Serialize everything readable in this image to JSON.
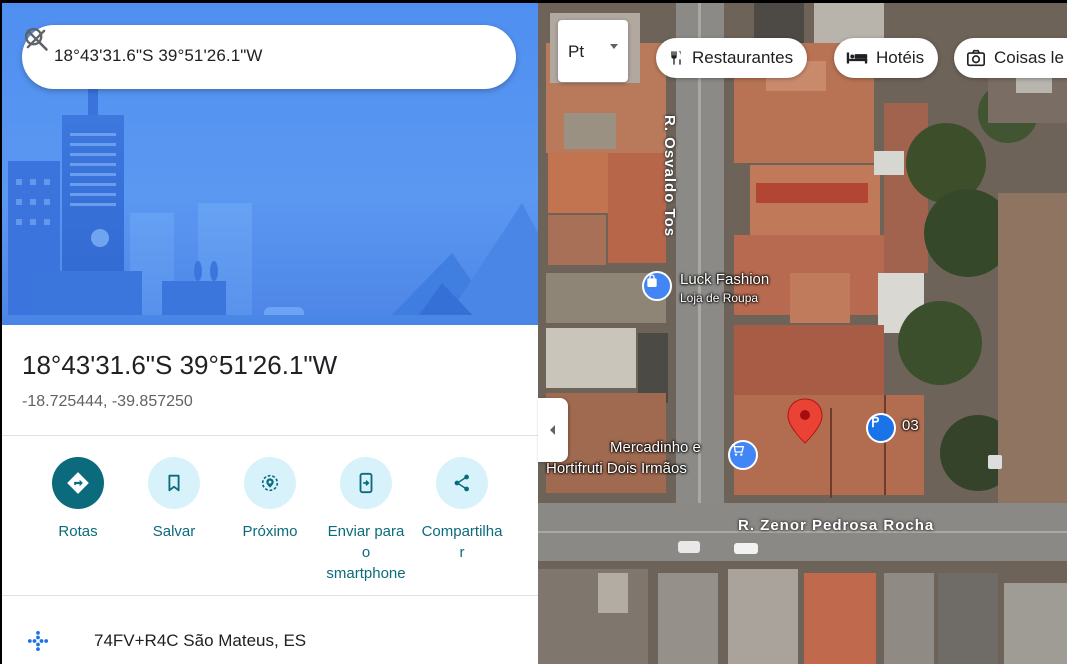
{
  "search": {
    "value": "18°43'31.6\"S 39°51'26.1\"W",
    "search_icon": "search-icon",
    "close_icon": "close-icon"
  },
  "place": {
    "title": "18°43'31.6\"S 39°51'26.1\"W",
    "decimal": "-18.725444, -39.857250"
  },
  "actions": [
    {
      "label": "Rotas",
      "icon": "directions-icon"
    },
    {
      "label": "Salvar",
      "icon": "bookmark-icon"
    },
    {
      "label": "Próximo",
      "icon": "nearby-icon"
    },
    {
      "label": "Enviar para o smartphone",
      "label_lines": [
        "Enviar para",
        "o",
        "smartphone"
      ],
      "icon": "send-to-phone-icon"
    },
    {
      "label": "Compartilhar",
      "label_lines": [
        "Compartilha",
        "r"
      ],
      "icon": "share-icon"
    }
  ],
  "plus_code": {
    "text": "74FV+R4C São Mateus, ES",
    "icon": "plus-code-icon"
  },
  "map": {
    "layer_button": "Pt",
    "chips": [
      {
        "label": "Restaurantes",
        "icon": "restaurant-icon"
      },
      {
        "label": "Hotéis",
        "icon": "hotel-icon"
      },
      {
        "label": "Coisas le",
        "icon": "camera-icon"
      }
    ],
    "streets": [
      "R. Osvaldo Tos",
      "R. Zenor Pedrosa Rocha"
    ],
    "pois": [
      {
        "name": "Luck Fashion",
        "category": "Loja de Roupa",
        "icon": "shopping-bag-icon",
        "color": "#4285f4"
      },
      {
        "name_lines": [
          "Mercadinho e",
          "Hortifruti Dois Irmãos"
        ],
        "icon": "shopping-cart-icon",
        "color": "#4285f4"
      },
      {
        "name": "03",
        "icon": "parking-icon",
        "color": "#1a73e8"
      }
    ],
    "pin_color": "#ea4335"
  },
  "colors": {
    "accent": "#0b6b7c",
    "action_bg": "#d7f2fb",
    "hero_blue": "#5b98f2"
  }
}
